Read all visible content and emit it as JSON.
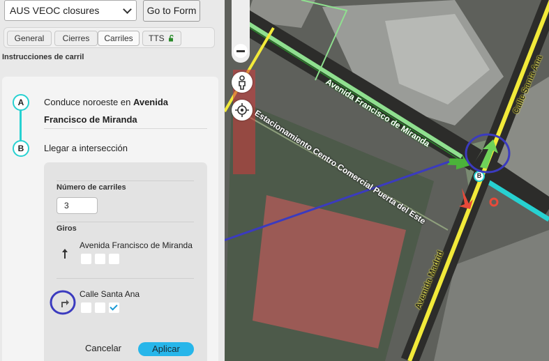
{
  "toolbar": {
    "dropdown_value": "AUS VEOC closures",
    "go_button": "Go to Form"
  },
  "tabs": [
    {
      "label": "General"
    },
    {
      "label": "Cierres"
    },
    {
      "label": "Carriles"
    },
    {
      "label": "TTS"
    }
  ],
  "section_title": "Instrucciones de carril",
  "instructions": {
    "a_marker": "A",
    "a_text_prefix": "Conduce noroeste en ",
    "a_street_line1": "Avenida",
    "a_street_line2": "Francisco de Miranda",
    "b_marker": "B",
    "b_text": "Llegar a intersección"
  },
  "editor": {
    "lanes_label": "Número de carriles",
    "lanes_value": "3",
    "turns_label": "Giros",
    "turns": [
      {
        "street": "Avenida Francisco de Miranda",
        "checks": [
          false,
          false,
          false
        ]
      },
      {
        "street": "Calle Santa Ana",
        "checks": [
          false,
          false,
          true
        ]
      }
    ],
    "cancel": "Cancelar",
    "apply": "Aplicar"
  },
  "map": {
    "labels": {
      "avenida_miranda": "Avenida Francisco de Miranda",
      "estacionamiento": "Estacionamiento Centro Comercial Puerta del Este",
      "calle_santa_ana": "Calle Santa Ana",
      "avenida_madrid": "Avenida Madrid",
      "node_b": "B"
    },
    "colors": {
      "primary_road": "#f2ea3a",
      "minor_road": "#8fe08f",
      "highlight": "#27d1d1",
      "annotation": "#3b3bbf",
      "arrow_ok": "#6fd25a",
      "arrow_bad": "#e84a3a"
    }
  }
}
